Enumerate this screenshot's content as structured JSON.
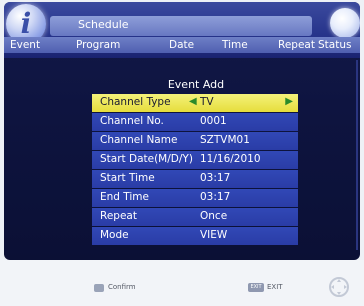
{
  "header": {
    "title": "Schedule",
    "columns": [
      "Event",
      "Program",
      "Date",
      "Time",
      "Repeat",
      "Status"
    ]
  },
  "dialog": {
    "title": "Event Add",
    "rows": [
      {
        "label": "Channel Type",
        "value": "TV",
        "selected": true
      },
      {
        "label": "Channel No.",
        "value": "0001"
      },
      {
        "label": "Channel Name",
        "value": "SZTVM01"
      },
      {
        "label": "Start Date(M/D/Y)",
        "value": "11/16/2010"
      },
      {
        "label": "Start Time",
        "value": "03:17"
      },
      {
        "label": "End Time",
        "value": "03:17"
      },
      {
        "label": "Repeat",
        "value": "Once"
      },
      {
        "label": "Mode",
        "value": "VIEW"
      }
    ]
  },
  "footer": {
    "confirm_label": "Confirm",
    "exit_key": "EXIT",
    "exit_label": "EXIT"
  },
  "icons": {
    "info": "info-icon",
    "globe": "globe-icon",
    "nav": "nav-pad-icon"
  },
  "colors": {
    "selection": "#e6dd3c",
    "row": "#2a3ca6",
    "background": "#0e1440"
  }
}
